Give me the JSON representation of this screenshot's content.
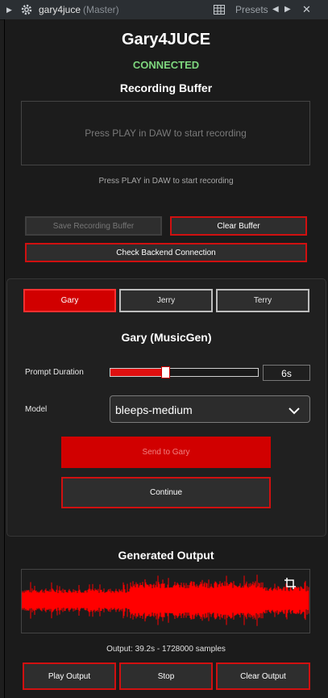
{
  "titlebar": {
    "plugin_name": "gary4juce",
    "track": "(Master)",
    "presets_label": "Presets"
  },
  "header": {
    "title": "Gary4JUCE",
    "status": "CONNECTED"
  },
  "recording": {
    "heading": "Recording Buffer",
    "placeholder": "Press PLAY in DAW to start recording",
    "status_text": "Press PLAY in DAW to start recording",
    "save_label": "Save Recording Buffer",
    "clear_label": "Clear Buffer",
    "check_label": "Check Backend Connection"
  },
  "tabs": [
    {
      "label": "Gary"
    },
    {
      "label": "Jerry"
    },
    {
      "label": "Terry"
    }
  ],
  "gary": {
    "heading": "Gary (MusicGen)",
    "prompt_label": "Prompt Duration",
    "prompt_value": "6s",
    "prompt_fraction": 0.37,
    "model_label": "Model",
    "model_value": "bleeps-medium",
    "send_label": "Send to Gary",
    "continue_label": "Continue"
  },
  "output": {
    "heading": "Generated Output",
    "info": "Output: 39.2s - 1728000 samples",
    "play_label": "Play Output",
    "stop_label": "Stop",
    "clear_label": "Clear Output"
  },
  "colors": {
    "accent": "#d10000",
    "connected": "#7ed67e",
    "waveform": "#ff0000"
  }
}
